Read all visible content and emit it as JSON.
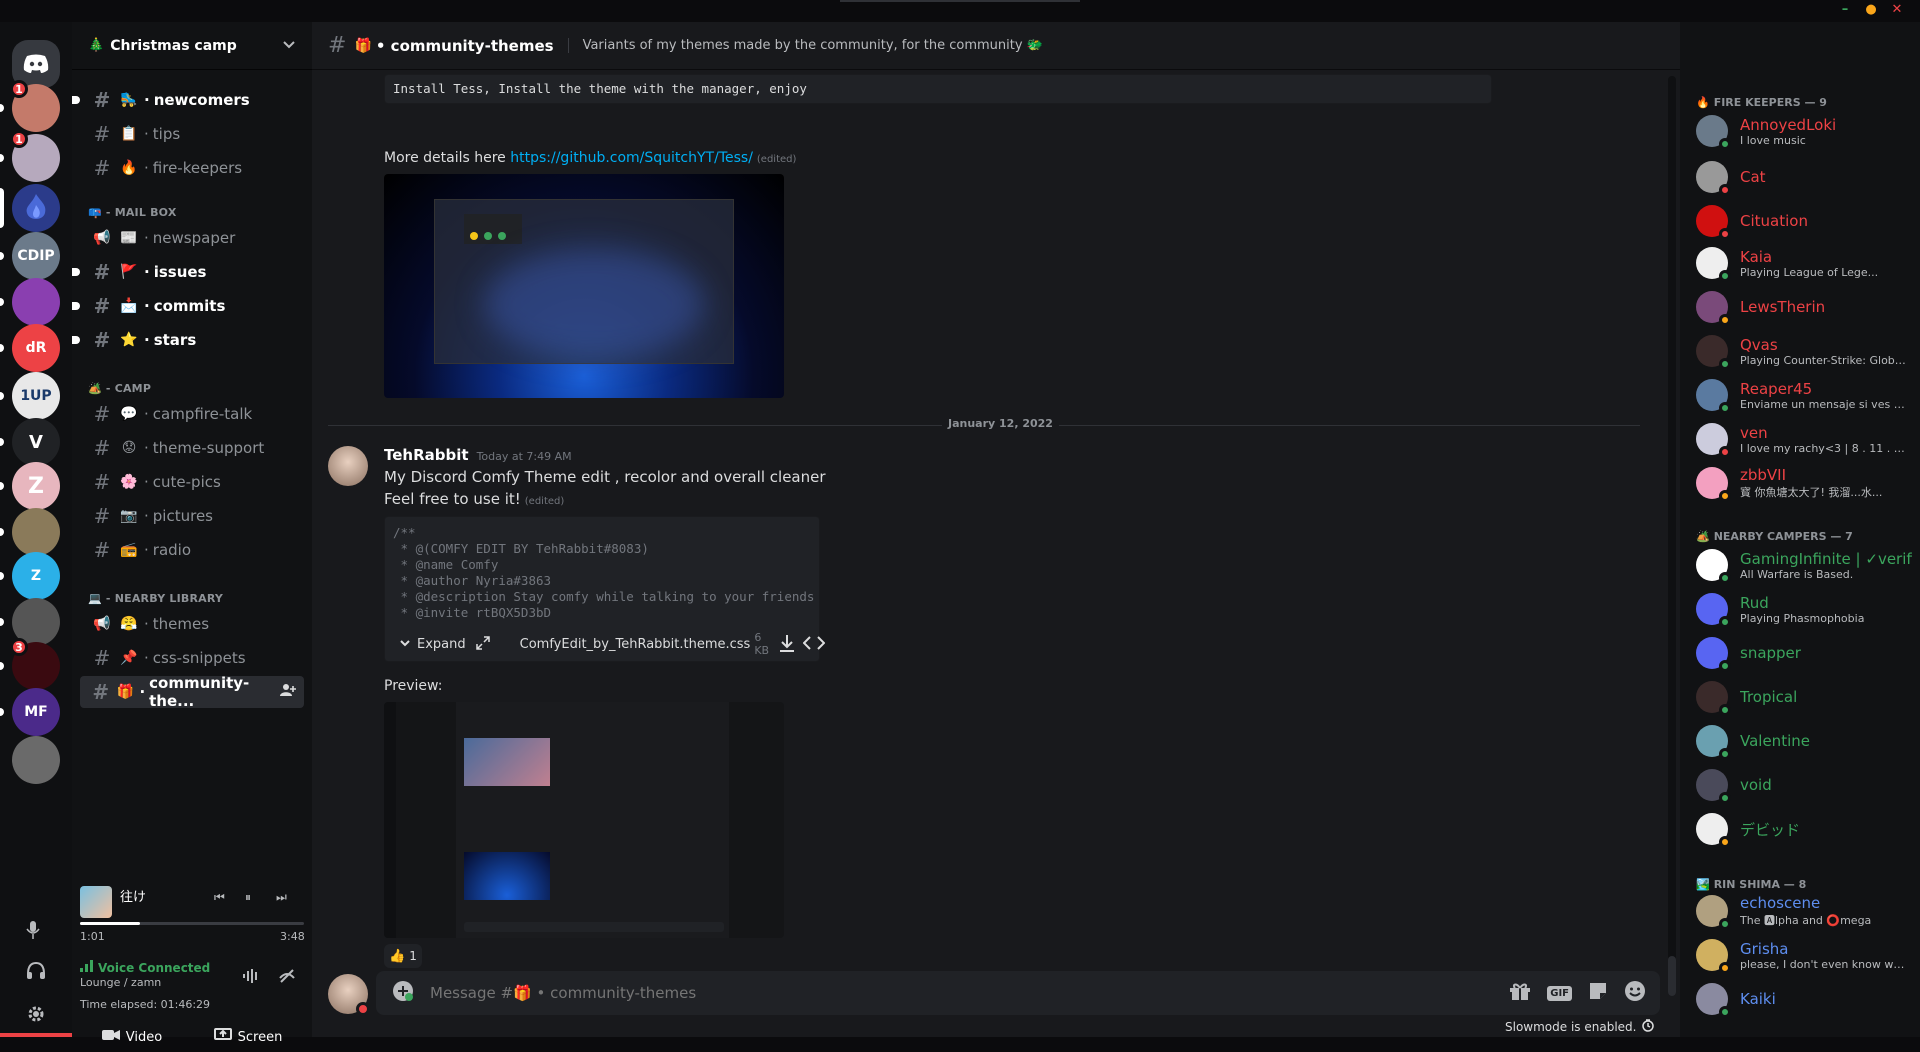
{
  "window": {
    "minimize": "–",
    "maximize": "●",
    "close": "✕"
  },
  "rail": {
    "servers": [
      {
        "name": "home",
        "label": "",
        "color": "#36393f",
        "icon": "discord-logo"
      },
      {
        "name": "server-1",
        "label": "",
        "color": "#c47a6a",
        "badge": "1"
      },
      {
        "name": "server-2",
        "label": "",
        "color": "#b6a9bd",
        "badge": "1"
      },
      {
        "name": "christmas-camp",
        "label": "",
        "color": "#2b3b8a",
        "active": true
      },
      {
        "name": "cdip",
        "label": "CDIP",
        "color": "#6b7a8a"
      },
      {
        "name": "server-6",
        "label": "",
        "color": "#8a3fb0"
      },
      {
        "name": "dr",
        "label": "dR",
        "color": "#ed4245"
      },
      {
        "name": "one-up",
        "label": "1UP",
        "color": "#e8e8e8"
      },
      {
        "name": "v",
        "label": "V",
        "color": "#202225"
      },
      {
        "name": "z",
        "label": "Z",
        "color": "#e7b6be"
      },
      {
        "name": "server-11",
        "label": "",
        "color": "#8a7a5a"
      },
      {
        "name": "zenith",
        "label": "Z",
        "color": "#2bb0e8"
      },
      {
        "name": "server-13",
        "label": "",
        "color": "#555"
      },
      {
        "name": "server-14",
        "label": "",
        "color": "#3a0a10",
        "badge": "3"
      },
      {
        "name": "mf",
        "label": "MF",
        "color": "#4b2a8a"
      },
      {
        "name": "server-16",
        "label": "",
        "color": "#6a6a6a"
      }
    ],
    "mic_icon": "mic-icon",
    "headphones_icon": "headphones-icon",
    "settings_icon": "gear-icon"
  },
  "sidebar": {
    "guild_name": "Christmas camp",
    "guild_emoji": "🎄",
    "channels_top": [
      {
        "emoji": "🛼",
        "name": "newcomers",
        "unread": true,
        "hash": "#"
      },
      {
        "emoji": "📋",
        "name": "tips",
        "unread": false,
        "hash": "#"
      },
      {
        "emoji": "🔥",
        "name": "fire-keepers",
        "unread": false,
        "hash": "#"
      }
    ],
    "cat_mailbox": {
      "emoji": "📪",
      "label": "- MAIL BOX"
    },
    "channels_mail": [
      {
        "emoji": "📰",
        "name": "newspaper",
        "unread": false,
        "hash": "📢"
      },
      {
        "emoji": "🚩",
        "name": "issues",
        "unread": true,
        "hash": "#"
      },
      {
        "emoji": "📩",
        "name": "commits",
        "unread": true,
        "hash": "#"
      },
      {
        "emoji": "⭐",
        "name": "stars",
        "unread": true,
        "hash": "#"
      }
    ],
    "cat_camp": {
      "emoji": "🏕️",
      "label": "- CAMP"
    },
    "channels_camp": [
      {
        "emoji": "💬",
        "name": "campfire-talk",
        "unread": false,
        "hash": "#"
      },
      {
        "emoji": "😟",
        "name": "theme-support",
        "unread": false,
        "hash": "#"
      },
      {
        "emoji": "🌸",
        "name": "cute-pics",
        "unread": false,
        "hash": "#"
      },
      {
        "emoji": "📷",
        "name": "pictures",
        "unread": false,
        "hash": "#"
      },
      {
        "emoji": "📻",
        "name": "radio",
        "unread": false,
        "hash": "#"
      }
    ],
    "cat_library": {
      "emoji": "💻",
      "label": "- NEARBY LIBRARY"
    },
    "channels_lib": [
      {
        "emoji": "😤",
        "name": "themes",
        "unread": false,
        "hash": "📢"
      },
      {
        "emoji": "📌",
        "name": "css-snippets",
        "unread": false,
        "hash": "#"
      },
      {
        "emoji": "🎁",
        "name": "community-the...",
        "unread": false,
        "hash": "#",
        "active": true
      }
    ],
    "music": {
      "title": "往け",
      "artist": "",
      "elapsed": "1:01",
      "total": "3:48",
      "progress": 0.27
    },
    "voice": {
      "status": "Voice Connected",
      "location": "Lounge / zamn",
      "elapsed": "Time elapsed: 01:46:29",
      "video": "Video",
      "screen": "Screen"
    }
  },
  "header": {
    "hash": "#",
    "emoji": "🎁",
    "channel": "• community-themes",
    "topic": "Variants of my themes made by the community, for the community",
    "topic_emoji": "🐲"
  },
  "messages": {
    "code_line": "Install Tess, Install the theme with the manager, enjoy",
    "details_prefix": "More details here ",
    "details_link": "https://github.com/SquitchYT/Tess/",
    "edited": "(edited)",
    "date_divider": "January 12, 2022",
    "author": "TehRabbit",
    "timestamp": "Today at 7:49 AM",
    "line1": "My Discord Comfy Theme edit , recolor and overall cleaner",
    "line2": "Feel free to use it!",
    "code": [
      "/**",
      " * @(COMFY EDIT BY TehRabbit#8083)",
      " * @name Comfy",
      " * @author Nyria#3863",
      " * @description Stay comfy while talking to your friends",
      " * @invite rtBQX5D3bD"
    ],
    "expand": "Expand",
    "filename": "ComfyEdit_by_TehRabbit.theme.css",
    "filesize": "6 KB",
    "preview": "Preview:",
    "reaction_emoji": "👍",
    "reaction_count": "1"
  },
  "composer": {
    "placeholder": "Message #🎁 • community-themes",
    "slowmode": "Slowmode is enabled."
  },
  "members": {
    "cat1": {
      "emoji": "🔥",
      "label": "FIRE KEEPERS — 9"
    },
    "group1": [
      {
        "name": "AnnoyedLoki",
        "sub": "I love music",
        "color": "#ed4245",
        "av": "#6a7a8a",
        "status": "#3ba55d"
      },
      {
        "name": "Cat",
        "sub": "",
        "color": "#ed4245",
        "av": "#999",
        "status": "#ed4245"
      },
      {
        "name": "Cituation",
        "sub": "",
        "color": "#ed4245",
        "av": "#d01010",
        "status": "#ed4245"
      },
      {
        "name": "Kaia",
        "sub": "Playing League of Lege...",
        "color": "#ed4245",
        "av": "#eee",
        "status": "#3ba55d"
      },
      {
        "name": "LewsTherin",
        "sub": "",
        "color": "#ed4245",
        "av": "#7a4a7a",
        "status": "#faa61a"
      },
      {
        "name": "Qvas",
        "sub": "Playing Counter-Strike: Global...",
        "color": "#ed4245",
        "av": "#3a2a2a",
        "status": "#3ba55d"
      },
      {
        "name": "Reaper45",
        "sub": "Enviame un mensaje si ves est...",
        "color": "#ed4245",
        "av": "#5a7aa0",
        "status": "#3ba55d"
      },
      {
        "name": "ven",
        "sub": "I love my rachy<3 | 8 . 11 . 2...",
        "color": "#ed4245",
        "av": "#ccd",
        "status": "#ed4245"
      },
      {
        "name": "zbbVII",
        "sub": "寳 你魚塘太大了! 我溜...水...",
        "color": "#ed4245",
        "av": "#f3a0c0",
        "status": "#faa61a"
      }
    ],
    "cat2": {
      "emoji": "🏕️",
      "label": "NEARBY CAMPERS — 7"
    },
    "group2": [
      {
        "name": "GamingInfinite | ✓verified",
        "sub": "All Warfare is Based.",
        "color": "#3ba55d",
        "av": "#fff",
        "status": "#3ba55d"
      },
      {
        "name": "Rud",
        "sub": "Playing Phasmophobia",
        "color": "#3ba55d",
        "av": "#5865f2",
        "status": "#3ba55d"
      },
      {
        "name": "snapper",
        "sub": "",
        "color": "#3ba55d",
        "av": "#5865f2",
        "status": "#3ba55d"
      },
      {
        "name": "Tropical",
        "sub": "",
        "color": "#3ba55d",
        "av": "#3a2a2a",
        "status": "#3ba55d"
      },
      {
        "name": "Valentine",
        "sub": "",
        "color": "#3ba55d",
        "av": "#6aa0b0",
        "status": "#3ba55d"
      },
      {
        "name": "void",
        "sub": "",
        "color": "#3ba55d",
        "av": "#4a4a5a",
        "status": "#3ba55d"
      },
      {
        "name": "デビッド",
        "sub": "",
        "color": "#3ba55d",
        "av": "#eee",
        "status": "#faa61a"
      }
    ],
    "cat3": {
      "emoji": "🏞️",
      "label": "RIN SHIMA — 8"
    },
    "group3": [
      {
        "name": "echoscene",
        "sub": "The 🅰lpha and ⭕mega",
        "color": "#5e8ef0",
        "av": "#b0a080",
        "status": "#3ba55d"
      },
      {
        "name": "Grisha",
        "sub": "please, I don't even know wher...",
        "color": "#5e8ef0",
        "av": "#d0b060",
        "status": "#faa61a"
      },
      {
        "name": "Kaiki",
        "sub": "",
        "color": "#5e8ef0",
        "av": "#8a8aa0",
        "status": "#3ba55d"
      }
    ]
  }
}
